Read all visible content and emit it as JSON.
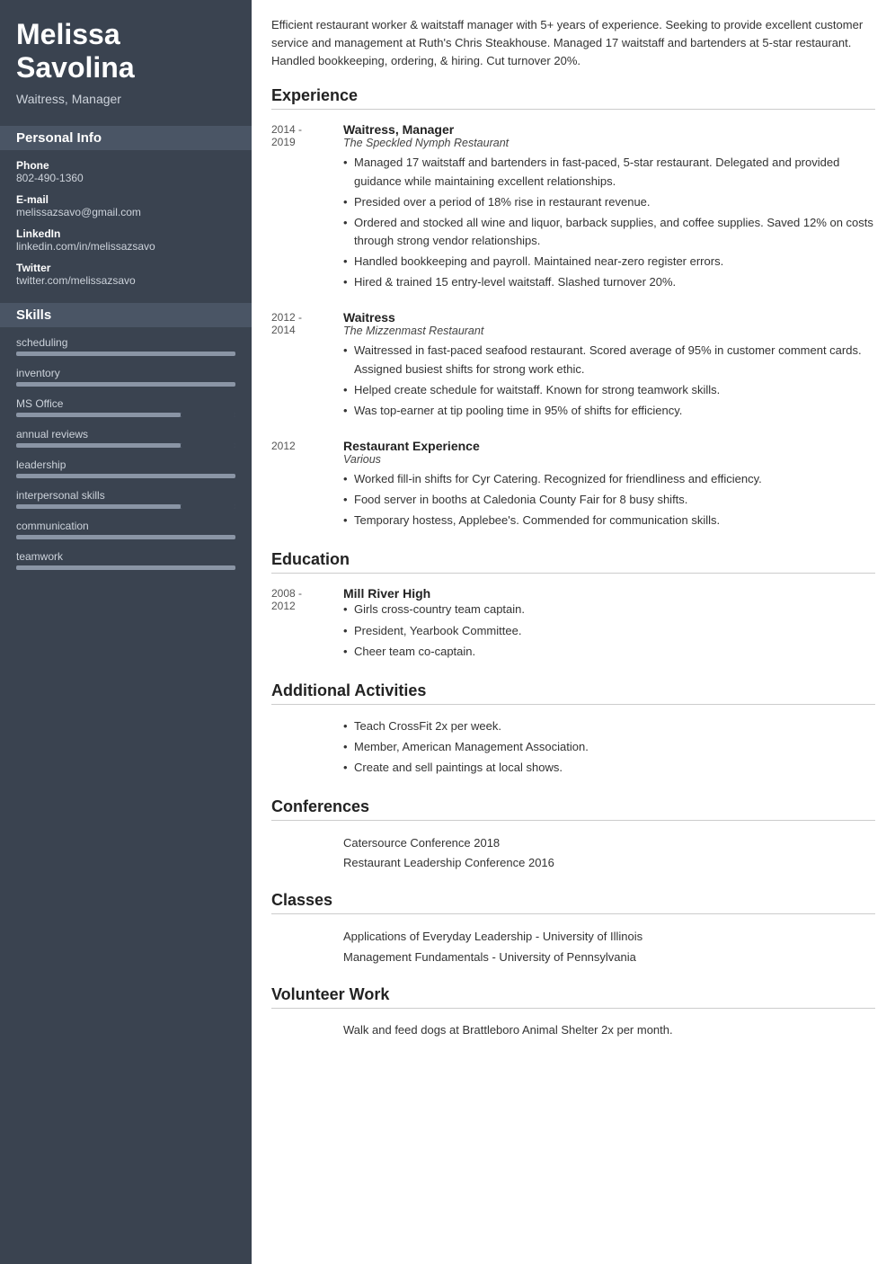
{
  "sidebar": {
    "name": "Melissa\nSavolina",
    "title": "Waitress, Manager",
    "personal_info_label": "Personal Info",
    "phone_label": "Phone",
    "phone_value": "802-490-1360",
    "email_label": "E-mail",
    "email_value": "melissazsavo@gmail.com",
    "linkedin_label": "LinkedIn",
    "linkedin_value": "linkedin.com/in/melissazsavo",
    "twitter_label": "Twitter",
    "twitter_value": "twitter.com/melissazsavo",
    "skills_label": "Skills",
    "skills": [
      {
        "name": "scheduling",
        "fill_pct": 100,
        "dark_start": null
      },
      {
        "name": "inventory",
        "fill_pct": 100,
        "dark_start": null
      },
      {
        "name": "MS Office",
        "fill_pct": 75,
        "dark_start": 75
      },
      {
        "name": "annual reviews",
        "fill_pct": 75,
        "dark_start": 75
      },
      {
        "name": "leadership",
        "fill_pct": 100,
        "dark_start": null
      },
      {
        "name": "interpersonal skills",
        "fill_pct": 75,
        "dark_start": 75
      },
      {
        "name": "communication",
        "fill_pct": 100,
        "dark_start": null
      },
      {
        "name": "teamwork",
        "fill_pct": 100,
        "dark_start": null
      }
    ]
  },
  "summary": "Efficient restaurant worker & waitstaff manager with 5+ years of experience. Seeking to provide excellent customer service and management at Ruth's Chris Steakhouse. Managed 17 waitstaff and bartenders at 5-star restaurant. Handled bookkeeping, ordering, & hiring. Cut turnover 20%.",
  "sections": {
    "experience_label": "Experience",
    "education_label": "Education",
    "activities_label": "Additional Activities",
    "conferences_label": "Conferences",
    "classes_label": "Classes",
    "volunteer_label": "Volunteer Work"
  },
  "experience": [
    {
      "date": "2014 -\n2019",
      "title": "Waitress, Manager",
      "company": "The Speckled Nymph Restaurant",
      "bullets": [
        "Managed 17 waitstaff and bartenders in fast-paced, 5-star restaurant. Delegated and provided guidance while maintaining excellent relationships.",
        "Presided over a period of 18% rise in restaurant revenue.",
        "Ordered and stocked all wine and liquor, barback supplies, and coffee supplies. Saved 12% on costs through strong vendor relationships.",
        "Handled bookkeeping and payroll. Maintained near-zero register errors.",
        "Hired & trained 15 entry-level waitstaff. Slashed turnover 20%."
      ]
    },
    {
      "date": "2012 -\n2014",
      "title": "Waitress",
      "company": "The Mizzenmast Restaurant",
      "bullets": [
        "Waitressed in fast-paced seafood restaurant. Scored average of 95% in customer comment cards. Assigned busiest shifts for strong work ethic.",
        "Helped create schedule for waitstaff. Known for strong teamwork skills.",
        "Was top-earner at tip pooling time in 95% of shifts for efficiency."
      ]
    },
    {
      "date": "2012",
      "title": "Restaurant Experience",
      "company": "Various",
      "bullets": [
        "Worked fill-in shifts for Cyr Catering. Recognized for friendliness and efficiency.",
        "Food server in booths at Caledonia County Fair for 8 busy shifts.",
        "Temporary hostess, Applebee's. Commended for communication skills."
      ]
    }
  ],
  "education": [
    {
      "date": "2008 -\n2012",
      "school": "Mill River High",
      "bullets": [
        "Girls cross-country team captain.",
        "President, Yearbook Committee.",
        "Cheer team co-captain."
      ]
    }
  ],
  "activities": [
    "Teach CrossFit 2x per week.",
    "Member, American Management Association.",
    "Create and sell paintings at local shows."
  ],
  "conferences": [
    "Catersource Conference 2018",
    "Restaurant Leadership Conference 2016"
  ],
  "classes": [
    "Applications of Everyday Leadership - University of Illinois",
    "Management Fundamentals - University of Pennsylvania"
  ],
  "volunteer": "Walk and feed dogs at Brattleboro Animal Shelter 2x per month."
}
